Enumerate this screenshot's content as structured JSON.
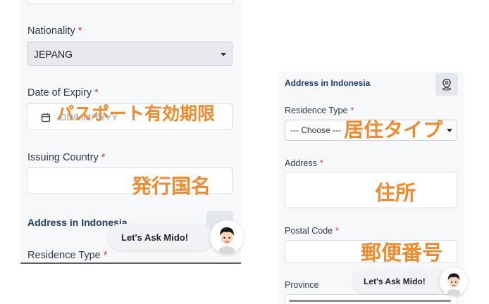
{
  "left": {
    "nationality_label": "Nationality",
    "required_mark": "*",
    "nationality_value": "JEPANG",
    "date_of_expiry_label": "Date of Expiry",
    "date_placeholder": "DD/MM/YYYY",
    "issuing_country_label": "Issuing Country",
    "address_section_title": "Address in Indonesia",
    "residence_type_label": "Residence Type",
    "ask_label": "Let's Ask Mido!"
  },
  "right": {
    "address_section_title": "Address in Indonesia",
    "residence_type_label": "Residence Type",
    "residence_type_value": "--- Choose ---",
    "address_label": "Address",
    "postal_code_label": "Postal Code",
    "province_label": "Province",
    "ask_label": "Let's Ask Mido!"
  },
  "annotations": {
    "passport_expiry": "パスポート有効期限",
    "issuing_country": "発行国名",
    "residence_type": "居住タイプ",
    "address": "住所",
    "postal_code": "郵便番号"
  },
  "colors": {
    "annotation": "#f08a2c",
    "section_title": "#1e3a6e",
    "required": "#e0353b"
  },
  "icons": [
    "calendar-icon",
    "map-pin-icon",
    "chevron-down-icon"
  ]
}
